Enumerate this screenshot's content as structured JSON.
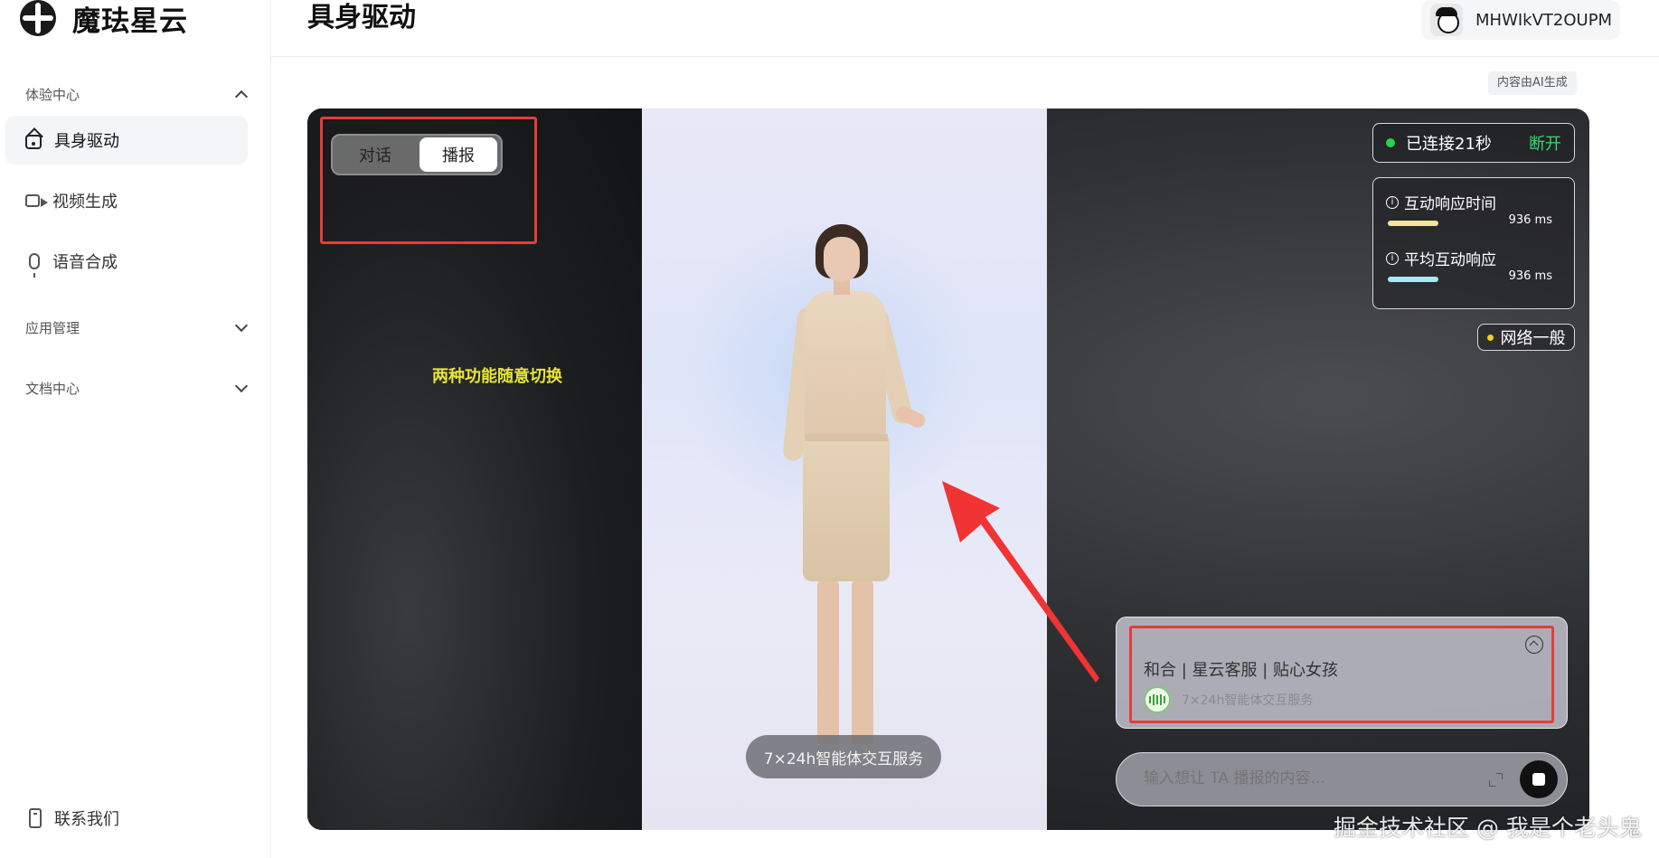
{
  "app": {
    "brand": "魔珐星云"
  },
  "sidebar": {
    "sections": [
      {
        "label": "体验中心",
        "expanded": true
      },
      {
        "label": "应用管理",
        "expanded": false
      },
      {
        "label": "文档中心",
        "expanded": false
      }
    ],
    "items": [
      {
        "label": "具身驱动",
        "icon": "home-icon",
        "active": true
      },
      {
        "label": "视频生成",
        "icon": "video-icon",
        "active": false
      },
      {
        "label": "语音合成",
        "icon": "mic-icon",
        "active": false
      }
    ],
    "footer_item": {
      "label": "联系我们",
      "icon": "phone-icon"
    }
  },
  "header": {
    "title": "具身驱动",
    "username": "MHWIkVT2OUPM"
  },
  "ai_tag": "内容由AI生成",
  "stage": {
    "mode_toggle": {
      "options": [
        "对话",
        "播报"
      ],
      "selected": "播报"
    },
    "annotation": "两种功能随意切换",
    "connection": {
      "status": "已连接21秒",
      "action": "断开",
      "status_color": "#28d148"
    },
    "metrics": [
      {
        "label": "互动响应时间",
        "value": "936 ms",
        "bar_color": "#f5e39a"
      },
      {
        "label": "平均互动响应",
        "value": "936 ms",
        "bar_color": "#a9e7f3"
      }
    ],
    "network": {
      "label": "网络一般",
      "color": "#f2d31b"
    },
    "caption": "7×24h智能体交互服务",
    "info_card": {
      "title": "和合 | 星云客服 | 贴心女孩",
      "subtitle": "7×24h智能体交互服务"
    },
    "input": {
      "placeholder": "输入想让 TA 播报的内容..."
    }
  },
  "watermark": "掘金技术社区 @ 我是个老头鬼"
}
